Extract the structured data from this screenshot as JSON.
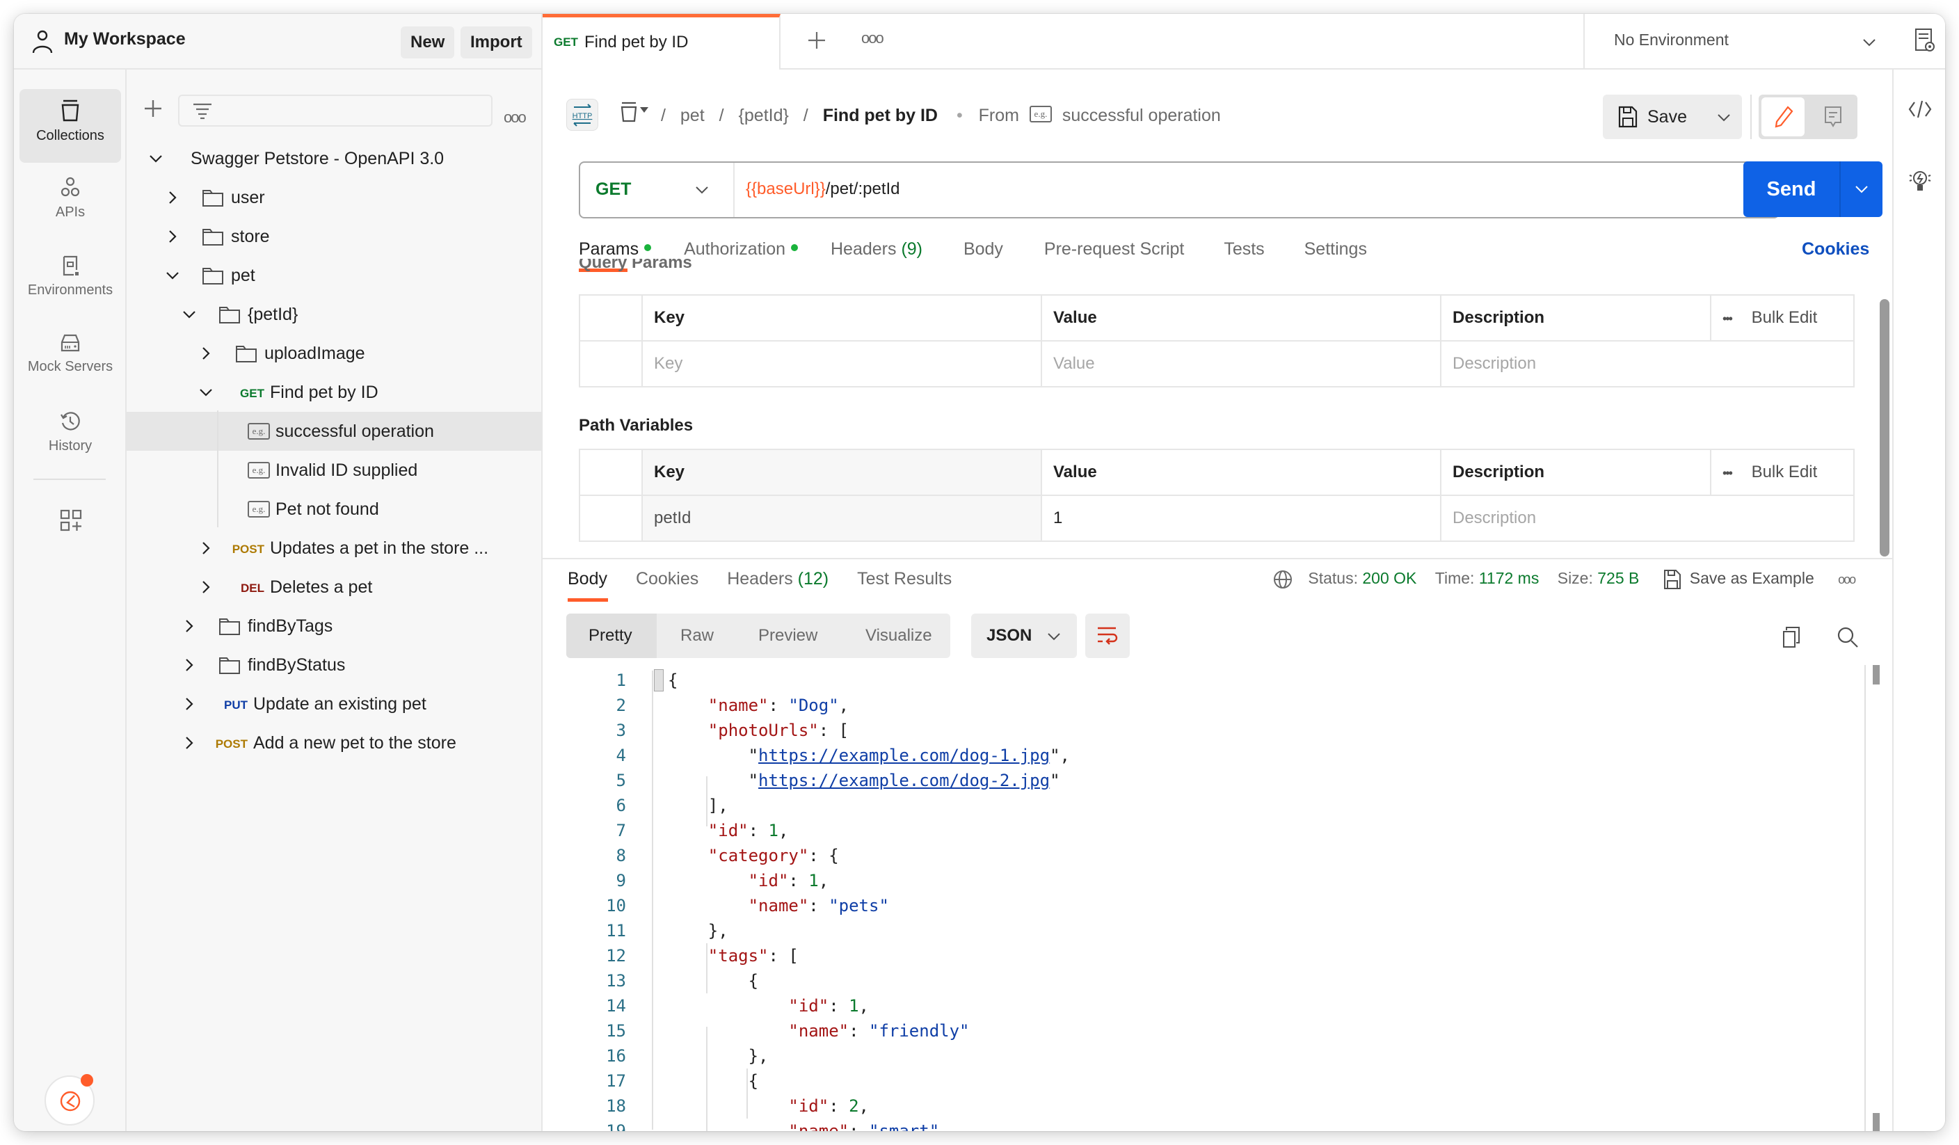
{
  "workspace": {
    "title": "My Workspace",
    "new_label": "New",
    "import_label": "Import"
  },
  "rail": {
    "items": [
      {
        "label": "Collections",
        "icon": "collections-icon",
        "active": true
      },
      {
        "label": "APIs",
        "icon": "apis-icon"
      },
      {
        "label": "Environments",
        "icon": "environments-icon"
      },
      {
        "label": "Mock Servers",
        "icon": "mock-servers-icon"
      },
      {
        "label": "History",
        "icon": "history-icon"
      }
    ]
  },
  "tree": {
    "collection": "Swagger Petstore - OpenAPI 3.0",
    "items": [
      {
        "label": "user",
        "type": "folder"
      },
      {
        "label": "store",
        "type": "folder"
      },
      {
        "label": "pet",
        "type": "folder"
      },
      {
        "label": "{petId}",
        "type": "folder"
      },
      {
        "label": "uploadImage",
        "type": "folder"
      },
      {
        "label": "Find pet by ID",
        "type": "request",
        "method": "GET"
      },
      {
        "label": "successful operation",
        "type": "example",
        "selected": true
      },
      {
        "label": "Invalid ID supplied",
        "type": "example"
      },
      {
        "label": "Pet not found",
        "type": "example"
      },
      {
        "label": "Updates a pet in the store ...",
        "type": "request",
        "method": "POST"
      },
      {
        "label": "Deletes a pet",
        "type": "request",
        "method": "DEL"
      },
      {
        "label": "findByTags",
        "type": "folder"
      },
      {
        "label": "findByStatus",
        "type": "folder"
      },
      {
        "label": "Update an existing pet",
        "type": "request",
        "method": "PUT"
      },
      {
        "label": "Add a new pet to the store",
        "type": "request",
        "method": "POST"
      }
    ]
  },
  "method_colors": {
    "GET": "#0b7a2d",
    "POST": "#ad7a03",
    "PUT": "#0f3ea6",
    "DEL": "#8e1a10"
  },
  "tabs": {
    "active": {
      "method": "GET",
      "label": "Find pet by ID"
    }
  },
  "environment": {
    "selected": "No Environment"
  },
  "breadcrumb": {
    "parts": [
      "pet",
      "{petId}"
    ],
    "current": "Find pet by ID",
    "from_label": "From",
    "example": "successful operation",
    "sep": "/"
  },
  "toolbar": {
    "save_label": "Save"
  },
  "request": {
    "method": "GET",
    "url_var": "{{baseUrl}}",
    "url_rest": "/pet/:petId",
    "send_label": "Send"
  },
  "req_tabs": {
    "params": "Params",
    "authorization": "Authorization",
    "headers": "Headers",
    "headers_count": "(9)",
    "body": "Body",
    "prerequest": "Pre-request Script",
    "tests": "Tests",
    "settings": "Settings",
    "cookies": "Cookies"
  },
  "query_params": {
    "title": "Query Params",
    "headers": {
      "key": "Key",
      "value": "Value",
      "description": "Description",
      "bulk": "Bulk Edit"
    },
    "placeholder": {
      "key": "Key",
      "value": "Value",
      "description": "Description"
    }
  },
  "path_variables": {
    "title": "Path Variables",
    "headers": {
      "key": "Key",
      "value": "Value",
      "description": "Description",
      "bulk": "Bulk Edit"
    },
    "rows": [
      {
        "key": "petId",
        "value": "1",
        "description_placeholder": "Description"
      }
    ]
  },
  "response": {
    "tabs": {
      "body": "Body",
      "cookies": "Cookies",
      "headers": "Headers",
      "headers_count": "(12)",
      "tests": "Test Results"
    },
    "status_label": "Status:",
    "status": "200 OK",
    "time_label": "Time:",
    "time": "1172 ms",
    "size_label": "Size:",
    "size": "725 B",
    "save_example": "Save as Example",
    "views": {
      "pretty": "Pretty",
      "raw": "Raw",
      "preview": "Preview",
      "visualize": "Visualize"
    },
    "format": "JSON"
  },
  "code_lines": [
    [
      [
        "p",
        "{"
      ]
    ],
    [
      [
        "p",
        "    "
      ],
      [
        "k",
        "\"name\""
      ],
      [
        "p",
        ": "
      ],
      [
        "s",
        "\"Dog\""
      ],
      [
        "p",
        ","
      ]
    ],
    [
      [
        "p",
        "    "
      ],
      [
        "k",
        "\"photoUrls\""
      ],
      [
        "p",
        ": ["
      ]
    ],
    [
      [
        "p",
        "        \""
      ],
      [
        "u",
        "https://example.com/dog-1.jpg"
      ],
      [
        "p",
        "\","
      ]
    ],
    [
      [
        "p",
        "        \""
      ],
      [
        "u",
        "https://example.com/dog-2.jpg"
      ],
      [
        "p",
        "\""
      ]
    ],
    [
      [
        "p",
        "    ],"
      ]
    ],
    [
      [
        "p",
        "    "
      ],
      [
        "k",
        "\"id\""
      ],
      [
        "p",
        ": "
      ],
      [
        "n",
        "1"
      ],
      [
        "p",
        ","
      ]
    ],
    [
      [
        "p",
        "    "
      ],
      [
        "k",
        "\"category\""
      ],
      [
        "p",
        ": {"
      ]
    ],
    [
      [
        "p",
        "        "
      ],
      [
        "k",
        "\"id\""
      ],
      [
        "p",
        ": "
      ],
      [
        "n",
        "1"
      ],
      [
        "p",
        ","
      ]
    ],
    [
      [
        "p",
        "        "
      ],
      [
        "k",
        "\"name\""
      ],
      [
        "p",
        ": "
      ],
      [
        "s",
        "\"pets\""
      ]
    ],
    [
      [
        "p",
        "    },"
      ]
    ],
    [
      [
        "p",
        "    "
      ],
      [
        "k",
        "\"tags\""
      ],
      [
        "p",
        ": ["
      ]
    ],
    [
      [
        "p",
        "        {"
      ]
    ],
    [
      [
        "p",
        "            "
      ],
      [
        "k",
        "\"id\""
      ],
      [
        "p",
        ": "
      ],
      [
        "n",
        "1"
      ],
      [
        "p",
        ","
      ]
    ],
    [
      [
        "p",
        "            "
      ],
      [
        "k",
        "\"name\""
      ],
      [
        "p",
        ": "
      ],
      [
        "s",
        "\"friendly\""
      ]
    ],
    [
      [
        "p",
        "        },"
      ]
    ],
    [
      [
        "p",
        "        {"
      ]
    ],
    [
      [
        "p",
        "            "
      ],
      [
        "k",
        "\"id\""
      ],
      [
        "p",
        ": "
      ],
      [
        "n",
        "2"
      ],
      [
        "p",
        ","
      ]
    ],
    [
      [
        "p",
        "            "
      ],
      [
        "k",
        "\"name\""
      ],
      [
        "p",
        ": "
      ],
      [
        "s",
        "\"smart\""
      ]
    ]
  ]
}
